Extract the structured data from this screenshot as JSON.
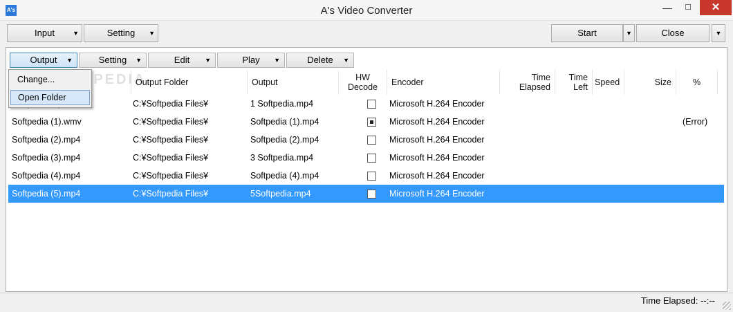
{
  "window": {
    "title": "A's Video Converter",
    "icon_text": "A's",
    "min_glyph": "—",
    "max_glyph": "☐",
    "close_glyph": "✕"
  },
  "toolbar": {
    "input": "Input",
    "setting": "Setting",
    "start": "Start",
    "close": "Close",
    "arrow": "▼"
  },
  "subtoolbar": {
    "output": "Output",
    "setting": "Setting",
    "edit": "Edit",
    "play": "Play",
    "delete": "Delete"
  },
  "columns": {
    "output_folder": "Output Folder",
    "output": "Output",
    "hw_decode_1": "HW",
    "hw_decode_2": "Decode",
    "encoder": "Encoder",
    "time_elapsed_1": "Time",
    "time_elapsed_2": "Elapsed",
    "time_left_1": "Time",
    "time_left_2": "Left",
    "speed": "Speed",
    "size": "Size",
    "percent": "%"
  },
  "rows": [
    {
      "input": "Softpedia.mp4",
      "folder": "C:¥Softpedia Files¥",
      "output": "1 Softpedia.mp4",
      "hw": false,
      "encoder": "Microsoft H.264 Encoder",
      "status": ""
    },
    {
      "input": "Softpedia (1).wmv",
      "folder": "C:¥Softpedia Files¥",
      "output": "Softpedia (1).mp4",
      "hw": true,
      "encoder": "Microsoft H.264 Encoder",
      "status": "(Error)"
    },
    {
      "input": "Softpedia (2).mp4",
      "folder": "C:¥Softpedia Files¥",
      "output": "Softpedia (2).mp4",
      "hw": false,
      "encoder": "Microsoft H.264 Encoder",
      "status": ""
    },
    {
      "input": "Softpedia (3).mp4",
      "folder": "C:¥Softpedia Files¥",
      "output": "3 Softpedia.mp4",
      "hw": false,
      "encoder": "Microsoft H.264 Encoder",
      "status": ""
    },
    {
      "input": "Softpedia (4).mp4",
      "folder": "C:¥Softpedia Files¥",
      "output": "Softpedia (4).mp4",
      "hw": false,
      "encoder": "Microsoft H.264 Encoder",
      "status": ""
    },
    {
      "input": "Softpedia (5).mp4",
      "folder": "C:¥Softpedia Files¥",
      "output": "5Softpedia.mp4",
      "hw": false,
      "encoder": "Microsoft H.264 Encoder",
      "status": ""
    }
  ],
  "selected_row": 5,
  "menu": {
    "change": "Change...",
    "open_folder": "Open Folder"
  },
  "status": {
    "text": "Time Elapsed: --:--"
  },
  "watermark": "SOFTPEDIA"
}
